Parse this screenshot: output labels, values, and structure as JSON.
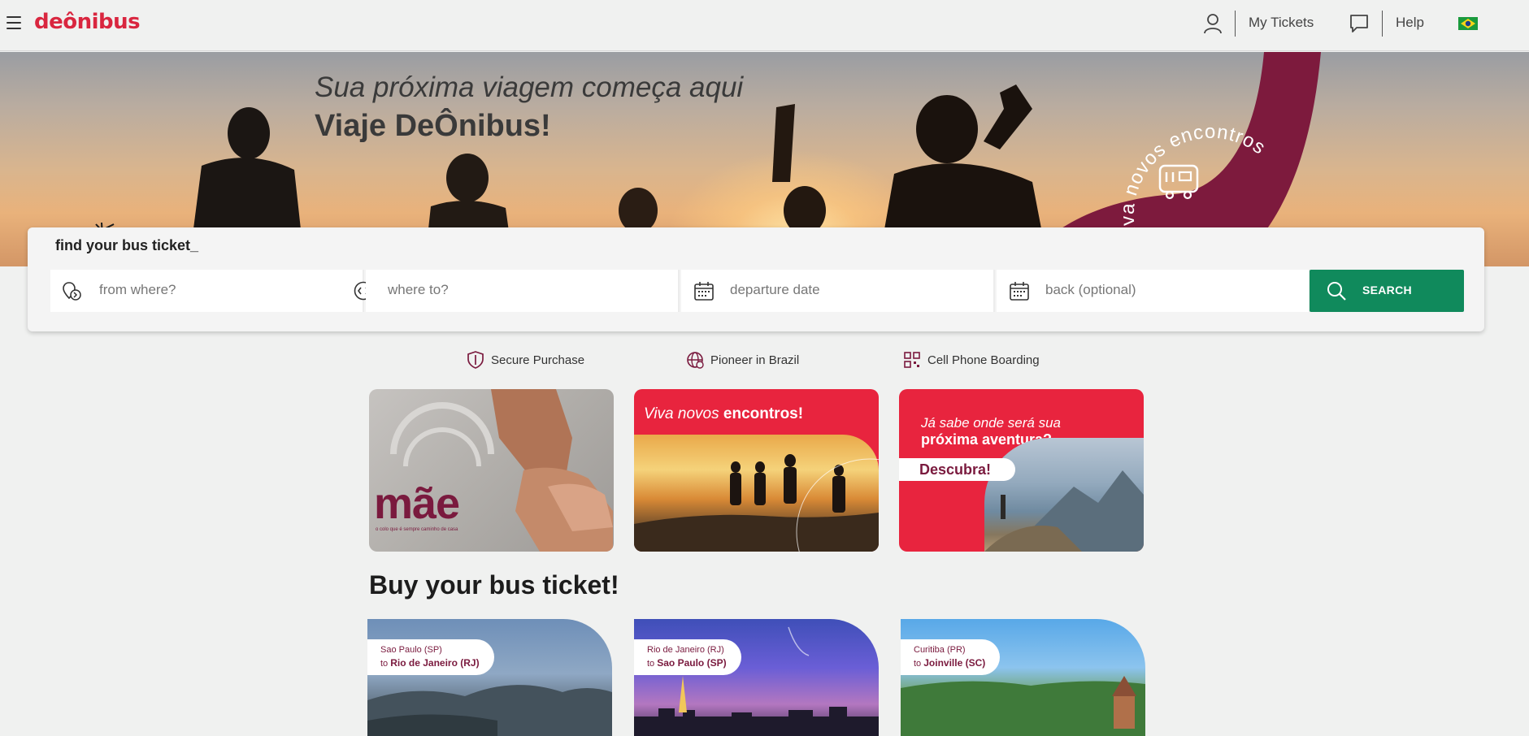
{
  "brand": {
    "logo_text": "deônibus",
    "accent": "#d9263f",
    "wine": "#7a1a3e",
    "green": "#108a5c"
  },
  "header": {
    "menu_icon": "hamburger-icon",
    "user_icon": "user-icon",
    "my_tickets_label": "My Tickets",
    "chat_icon": "chat-bubble-icon",
    "help_label": "Help",
    "language_flag": "brazil-flag-icon"
  },
  "hero": {
    "subtitle": "Sua próxima viagem começa aqui",
    "title": "Viaje DeÔnibus!",
    "badge_text": "viva novos encontros",
    "badge_icon": "bus-icon"
  },
  "search": {
    "title": "find your bus ticket_",
    "from_placeholder": "from where?",
    "swap_icon": "swap-icon",
    "to_placeholder": "where to?",
    "departure_placeholder": "departure date",
    "return_placeholder": "back (optional)",
    "button_label": "SEARCH"
  },
  "features": [
    {
      "icon": "shield-icon",
      "label": "Secure Purchase"
    },
    {
      "icon": "globe-icon",
      "label": "Pioneer in Brazil"
    },
    {
      "icon": "qr-code-icon",
      "label": "Cell Phone Boarding"
    }
  ],
  "promos": [
    {
      "title": "mãe",
      "subtitle": "o colo que é sempre caminho de casa"
    },
    {
      "caption_light": "Viva novos ",
      "caption_bold": "encontros!"
    },
    {
      "caption_line1": "Já sabe onde será sua",
      "caption_line2": "próxima aventura?",
      "pill": "Descubra!"
    }
  ],
  "section": {
    "title": "Buy your bus ticket!"
  },
  "routes": [
    {
      "from": "Sao Paulo (SP)",
      "to_prefix": "to ",
      "to": "Rio de Janeiro (RJ)"
    },
    {
      "from": "Rio de Janeiro (RJ)",
      "to_prefix": "to ",
      "to": "Sao Paulo (SP)"
    },
    {
      "from": "Curitiba (PR)",
      "to_prefix": "to ",
      "to": "Joinville (SC)"
    }
  ]
}
